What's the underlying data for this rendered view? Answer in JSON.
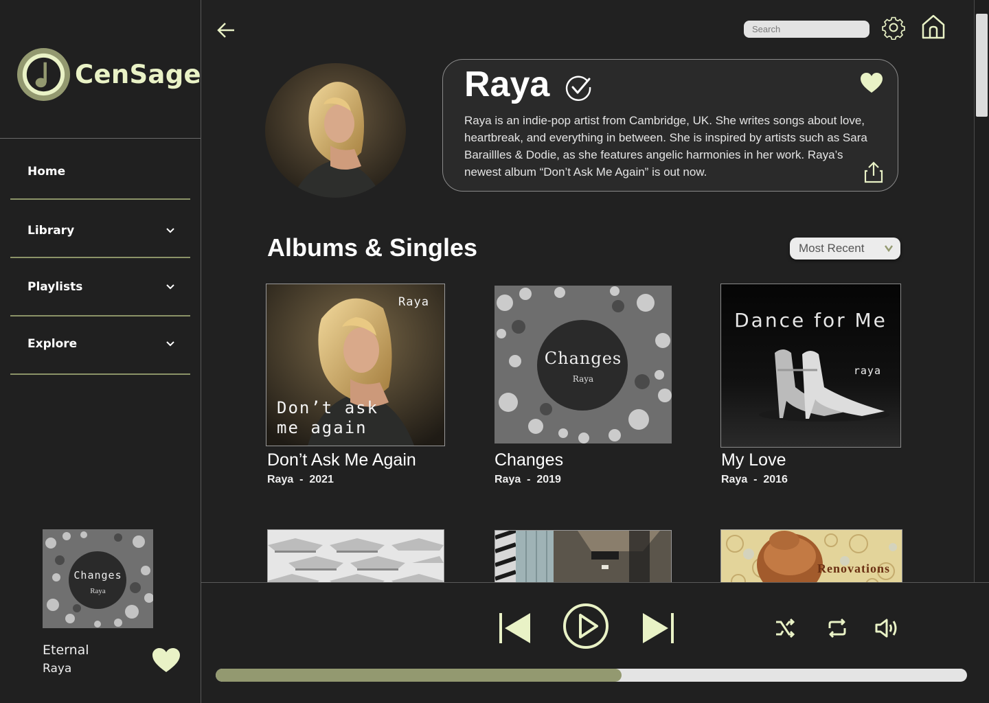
{
  "app": {
    "name": "CenSage"
  },
  "colors": {
    "accent": "#e9f2c6",
    "accent_dark": "#939970",
    "background": "#212121"
  },
  "sidebar": {
    "items": [
      {
        "label": "Home",
        "has_dropdown": false
      },
      {
        "label": "Library",
        "has_dropdown": true
      },
      {
        "label": "Playlists",
        "has_dropdown": true
      },
      {
        "label": "Explore",
        "has_dropdown": true
      }
    ],
    "now_playing": {
      "cover_title": "Changes",
      "cover_artist": "Raya",
      "title": "Eternal",
      "artist": "Raya",
      "liked": true
    }
  },
  "header": {
    "search_placeholder": "Search",
    "icons": [
      "back-arrow-icon",
      "gear-icon",
      "home-icon"
    ]
  },
  "artist": {
    "name": "Raya",
    "verified": true,
    "favorited": true,
    "bio": "Raya is an indie-pop artist from Cambridge, UK. She writes songs about love, heartbreak, and everything in between. She is inspired by artists such as Sara Baraillles & Dodie, as she features angelic harmonies in her work. Raya’s newest album “Don’t Ask Me Again” is out now."
  },
  "albums_section": {
    "title": "Albums & Singles",
    "sort": "Most Recent",
    "albums": [
      {
        "title": "Don’t Ask Me Again",
        "artist": "Raya",
        "year": "2021",
        "cover_line1": "Don’t ask",
        "cover_line2": "me again",
        "cover_artist": "Raya"
      },
      {
        "title": "Changes",
        "artist": "Raya",
        "year": "2019",
        "cover_title": "Changes",
        "cover_artist": "Raya"
      },
      {
        "title": "My Love",
        "artist": "Raya",
        "year": "2016",
        "cover_title": "Dance for Me",
        "cover_artist": "raya"
      }
    ],
    "partial_row": [
      {
        "cover_text": ""
      },
      {
        "cover_text": ""
      },
      {
        "cover_text": "Renovations"
      }
    ]
  },
  "player": {
    "progress_fraction": 0.54,
    "controls": [
      "previous-icon",
      "play-icon",
      "next-icon",
      "shuffle-icon",
      "repeat-icon",
      "volume-icon"
    ]
  }
}
